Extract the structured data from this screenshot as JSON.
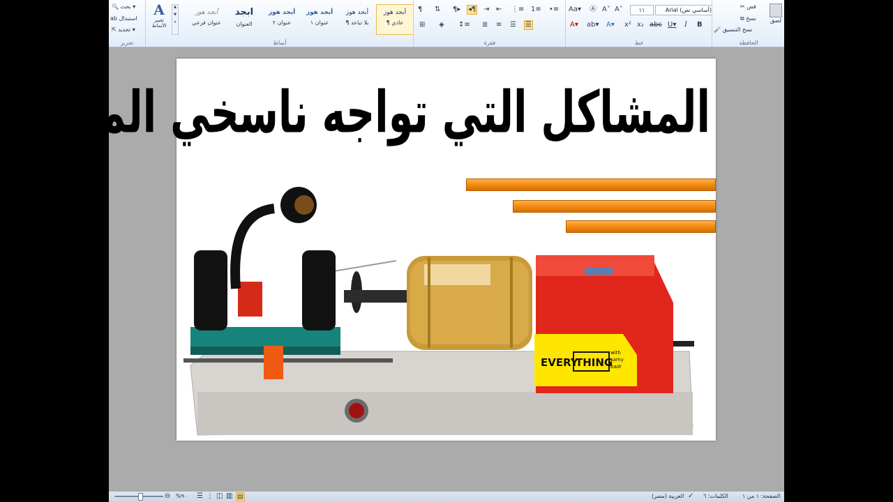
{
  "ribbon": {
    "clipboard": {
      "paste": "لصق",
      "cut": "قص",
      "copy": "نسخ",
      "format_painter": "نسخ التنسيق",
      "label": "الحافظة"
    },
    "font": {
      "font_name": "Arial (أساسي نص)",
      "font_size": "١١",
      "label": "خط"
    },
    "paragraph": {
      "label": "فقرة"
    },
    "styles": {
      "label": "أنماط",
      "change_styles": "تغيير الأنماط",
      "items": [
        {
          "sample": "أبجد هوز",
          "name": "¶ عادي"
        },
        {
          "sample": "أبجد هوز",
          "name": "¶ بلا تباعد"
        },
        {
          "sample": "أبجد هوز",
          "name": "عنوان ١"
        },
        {
          "sample": "أبجد هوز",
          "name": "عنوان ٢"
        },
        {
          "sample": "ابجد",
          "name": "العنوان"
        },
        {
          "sample": "أبجد هوز",
          "name": "عنوان فرعي"
        }
      ]
    },
    "editing": {
      "find": "بحث",
      "replace": "استبدال",
      "select": "تحديد",
      "label": "تحرير"
    }
  },
  "document": {
    "headline": "المشاكل التي تواجه ناسخي المفاتيح المبتدئين",
    "logo_text": {
      "every": "EVERY",
      "thing": "THING",
      "with": "with",
      "samy": "samy",
      "badr": "badr"
    }
  },
  "status_bar": {
    "page": "الصفحة: ١ من ١",
    "words": "الكلمات: ٦",
    "language": "العربية (مصر)",
    "zoom": "٩٠%"
  },
  "colors": {
    "accent_orange": "#f28a12",
    "machine_red": "#e1261c",
    "brass": "#c89a3a",
    "logo_yellow": "#ffe600"
  }
}
